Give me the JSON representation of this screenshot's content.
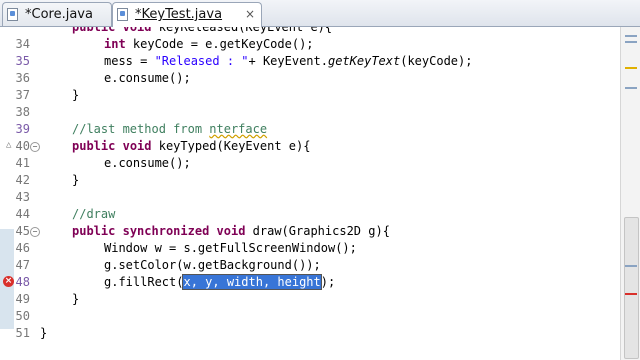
{
  "tabs": [
    {
      "label": "*Core.java",
      "active": false,
      "close": "×"
    },
    {
      "label": "*KeyTest.java",
      "active": true,
      "close": "×"
    }
  ],
  "line_numbers": [
    "34",
    "35",
    "36",
    "37",
    "38",
    "39",
    "40",
    "41",
    "42",
    "43",
    "44",
    "45",
    "46",
    "47",
    "48",
    "49",
    "50",
    "51"
  ],
  "code": {
    "l33": "public void keyReleased(KeyEvent e){",
    "l34_kw": "int",
    "l34_rest": " keyCode = e.getKeyCode();",
    "l35_a": "mess = ",
    "l35_str": "\"Released : \"",
    "l35_b": "+ KeyEvent.",
    "l35_it": "getKeyText",
    "l35_c": "(keyCode);",
    "l36": "e.consume();",
    "l37": "}",
    "l39_cm": "//last method from ",
    "l39_ul": "nterface",
    "l40_kw1": "public",
    "l40_kw2": "void",
    "l40_rest": " keyTyped(KeyEvent e){",
    "l41": "e.consume();",
    "l42": "}",
    "l44_cm": "//draw",
    "l45_kw1": "public",
    "l45_kw2": "synchronized",
    "l45_kw3": "void",
    "l45_rest": " draw(Graphics2D g){",
    "l46": "Window w = s.getFullScreenWindow();",
    "l47": "g.setColor(w.getBackground());",
    "l48_a": "g.fillRect(",
    "l48_sel": "x, y, width, height",
    "l48_b": ");",
    "l49": "}",
    "l51": "}"
  },
  "colors": {
    "keyword": "#7f0055",
    "string": "#2a00ff",
    "comment": "#3f7f5f",
    "selection": "#3875d7",
    "error": "#d9302b"
  },
  "icons": {
    "error": "error-icon",
    "warning": "warning-marker",
    "fold": "fold-toggle-icon"
  }
}
